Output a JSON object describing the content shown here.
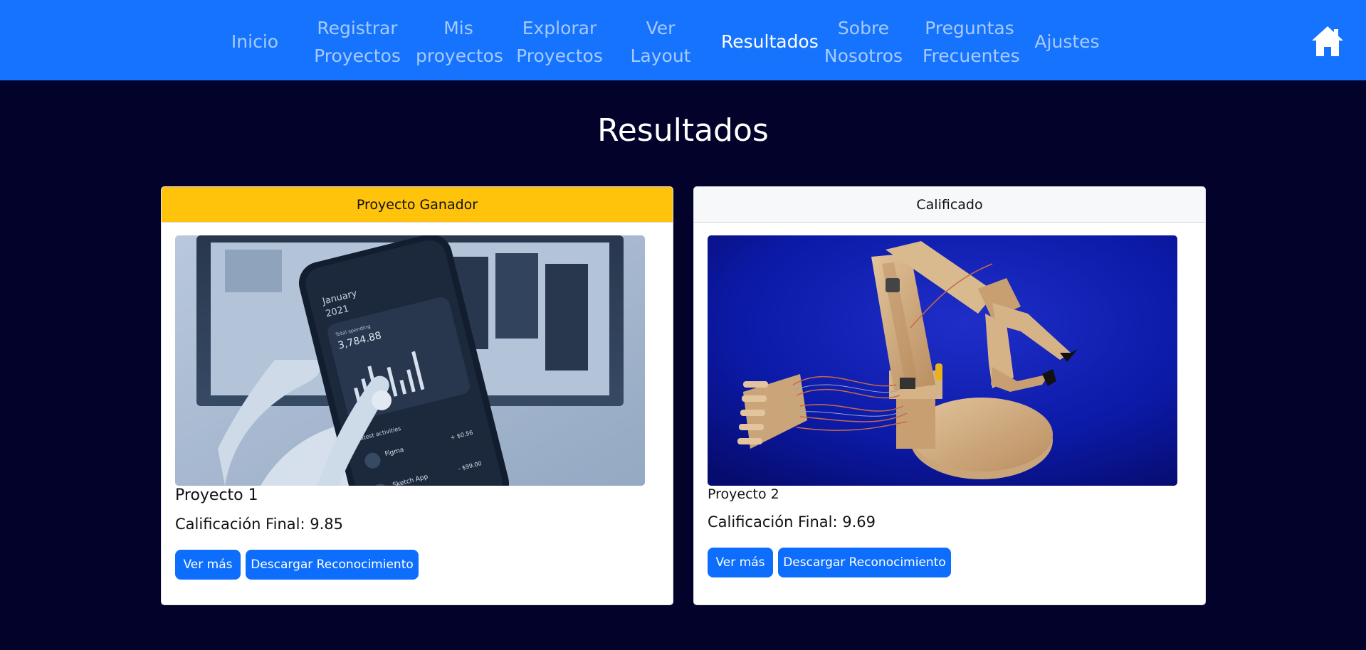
{
  "nav": {
    "items": [
      {
        "label": "Inicio",
        "active": false
      },
      {
        "label": "Registrar\nProyectos",
        "active": false
      },
      {
        "label": "Mis\nproyectos",
        "active": false
      },
      {
        "label": "Explorar\nProyectos",
        "active": false
      },
      {
        "label": "Ver\nLayout",
        "active": false
      },
      {
        "label": "Resultados",
        "active": true
      },
      {
        "label": "Sobre\nNosotros",
        "active": false
      },
      {
        "label": "Preguntas\nFrecuentes",
        "active": false
      },
      {
        "label": "Ajustes",
        "active": false
      }
    ],
    "home_icon": "home-icon"
  },
  "page": {
    "title": "Resultados"
  },
  "results": [
    {
      "header": "Proyecto Ganador",
      "name": "Proyecto 1",
      "grade": "Calificación Final: 9.85",
      "image": "phone-app-photo",
      "more_label": "Ver más",
      "download_label": "Descargar Reconocimiento"
    },
    {
      "header": "Calificado",
      "name": "Proyecto 2",
      "grade": "Calificación Final: 9.69",
      "image": "robot-arm-photo",
      "more_label": "Ver más",
      "download_label": "Descargar Reconocimiento"
    }
  ],
  "phone_screen": {
    "month": "January",
    "year": "2021",
    "spending_label": "Total spending",
    "amount": "3,784.88",
    "activities_label": "Latest activities",
    "activity_1": "Figma",
    "activity_1_value": "+ $0.56",
    "activity_2": "Sketch App",
    "activity_2_value": "- $99.00"
  },
  "colors": {
    "navbar": "#1673fd",
    "page_bg": "#02022a",
    "winner_header": "#fec30a",
    "button": "#0d6efd"
  }
}
